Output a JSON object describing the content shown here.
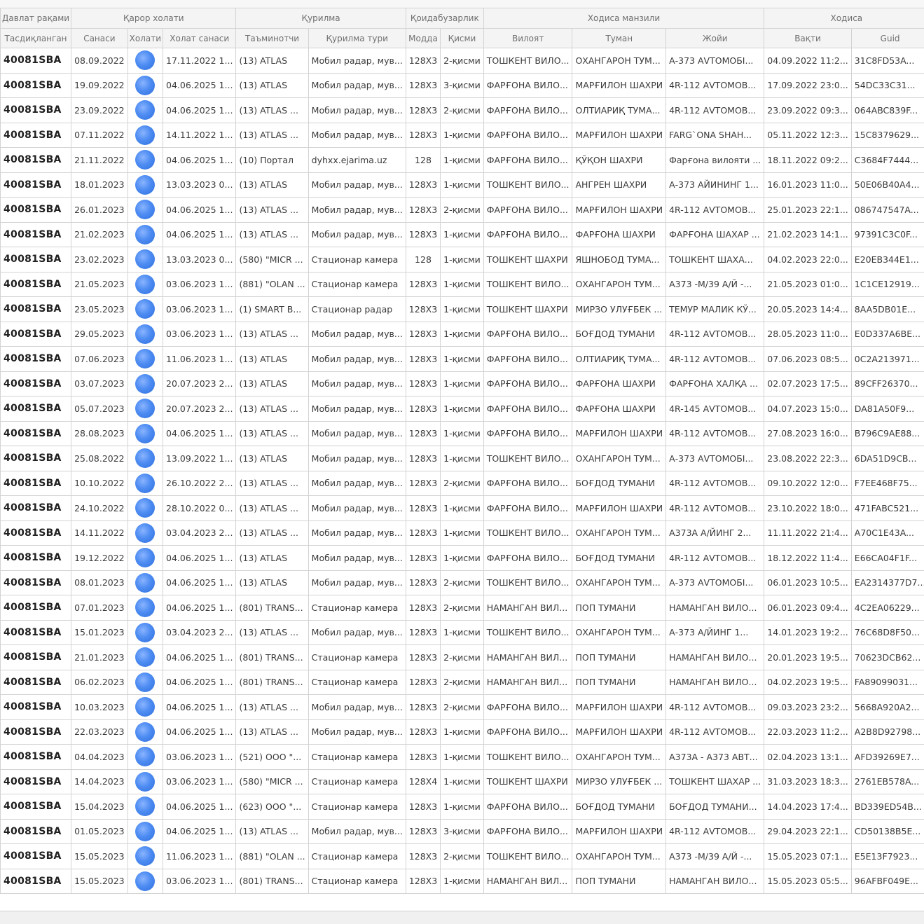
{
  "groups": [
    {
      "label": "Давлат рақами",
      "span": 1
    },
    {
      "label": "Қарор холати",
      "span": 3
    },
    {
      "label": "Қурилма",
      "span": 2
    },
    {
      "label": "Қоидабузарлик",
      "span": 2
    },
    {
      "label": "Ходиса манзили",
      "span": 3
    },
    {
      "label": "Ходиса",
      "span": 2
    }
  ],
  "columns": [
    {
      "label": "Тасдиқланган",
      "w": 102
    },
    {
      "label": "Санаси",
      "w": 89
    },
    {
      "label": "Холати",
      "w": 54
    },
    {
      "label": "Холат санаси",
      "w": 106
    },
    {
      "label": "Таъминотчи",
      "w": 95
    },
    {
      "label": "Қурилма тури",
      "w": 133
    },
    {
      "label": "Модда",
      "w": 66
    },
    {
      "label": "Қисми",
      "w": 66
    },
    {
      "label": "Вилоят",
      "w": 126
    },
    {
      "label": "Туман",
      "w": 128
    },
    {
      "label": "Жойи",
      "w": 130
    },
    {
      "label": "Вақти",
      "w": 124
    },
    {
      "label": "Guid",
      "w": 100
    }
  ],
  "rows": [
    [
      "40081SBA",
      "08.09.2022",
      "17.11.2022 1...",
      "(13) ATLAS",
      "Мобил радар, мув...",
      "128X3",
      "2-қисми",
      "ТОШКЕНТ ВИЛО...",
      "ОХАНГАРОН ТУМ...",
      "А-373 АVТОМОБІ...",
      "04.09.2022 11:2...",
      "31C8FD53A..."
    ],
    [
      "40081SBA",
      "19.09.2022",
      "04.06.2025 1...",
      "(13) ATLAS",
      "Мобил радар, мув...",
      "128X3",
      "3-қисми",
      "ФАРҒОНА ВИЛО...",
      "МАРҒИЛОН ШАХРИ",
      "4R-112 АVТОМОВ...",
      "17.09.2022 23:0...",
      "54DC33C31..."
    ],
    [
      "40081SBA",
      "23.09.2022",
      "04.06.2025 1...",
      "(13) ATLAS ...",
      "Мобил радар, мув...",
      "128X3",
      "2-қисми",
      "ФАРҒОНА ВИЛО...",
      "ОЛТИАРИҚ ТУМА...",
      "4R-112 АVТОМОВ...",
      "23.09.2022 09:3...",
      "064ABC839F..."
    ],
    [
      "40081SBA",
      "07.11.2022",
      "14.11.2022 1...",
      "(13) ATLAS ...",
      "Мобил радар, мув...",
      "128X3",
      "1-қисми",
      "ФАРҒОНА ВИЛО...",
      "МАРҒИЛОН ШАХРИ",
      "FARG`ONA SHAH...",
      "05.11.2022 12:3...",
      "15C8379629..."
    ],
    [
      "40081SBA",
      "21.11.2022",
      "04.06.2025 1...",
      "(10) Портал",
      "dyhxx.ejarima.uz",
      "128",
      "1-қисми",
      "ФАРҒОНА ВИЛО...",
      "ҚЎҚОН ШАХРИ",
      "Фарғона вилояти ...",
      "18.11.2022 09:2...",
      "C3684F7444..."
    ],
    [
      "40081SBA",
      "18.01.2023",
      "13.03.2023 0...",
      "(13) ATLAS",
      "Мобил радар, мув...",
      "128X3",
      "1-қисми",
      "ТОШКЕНТ ВИЛО...",
      "АНГРЕН ШАХРИ",
      "А-373 АЙИНИНГ 1...",
      "16.01.2023 11:0...",
      "50E06B40A4..."
    ],
    [
      "40081SBA",
      "26.01.2023",
      "04.06.2025 1...",
      "(13) ATLAS ...",
      "Мобил радар, мув...",
      "128X3",
      "2-қисми",
      "ФАРҒОНА ВИЛО...",
      "МАРҒИЛОН ШАХРИ",
      "4R-112 АVТОМОВ...",
      "25.01.2023 22:1...",
      "086747547A..."
    ],
    [
      "40081SBA",
      "21.02.2023",
      "04.06.2025 1...",
      "(13) ATLAS ...",
      "Мобил радар, мув...",
      "128X3",
      "1-қисми",
      "ФАРҒОНА ВИЛО...",
      "ФАРҒОНА ШАХРИ",
      "ФАРҒОНА ШАХАР ...",
      "21.02.2023 14:1...",
      "97391C3C0F..."
    ],
    [
      "40081SBA",
      "23.02.2023",
      "13.03.2023 0...",
      "(580) \"MICR ...",
      "Стационар камера",
      "128",
      "1-қисми",
      "ТОШКЕНТ ШАХРИ",
      "ЯШНОБОД ТУМА...",
      "ТОШКЕНТ ШАХА...",
      "04.02.2023 22:0...",
      "E20EB344E1..."
    ],
    [
      "40081SBA",
      "21.05.2023",
      "03.06.2023 1...",
      "(881) \"OLAN ...",
      "Стационар камера",
      "128X3",
      "1-қисми",
      "ТОШКЕНТ ВИЛО...",
      "ОХАНГАРОН ТУМ...",
      "А373 -М/39 А/Й -...",
      "21.05.2023 01:0...",
      "1C1CE12919..."
    ],
    [
      "40081SBA",
      "23.05.2023",
      "03.06.2023 1...",
      "(1) SMART B...",
      "Стационар радар",
      "128X3",
      "1-қисми",
      "ТОШКЕНТ ШАХРИ",
      "МИРЗО УЛУҒБЕК ...",
      "ТЕМУР МАЛИК КЎ...",
      "20.05.2023 14:4...",
      "8AA5DB01E..."
    ],
    [
      "40081SBA",
      "29.05.2023",
      "03.06.2023 1...",
      "(13) ATLAS ...",
      "Мобил радар, мув...",
      "128X3",
      "1-қисми",
      "ФАРҒОНА ВИЛО...",
      "БОҒДОД ТУМАНИ",
      "4R-112 АVТОМОВ...",
      "28.05.2023 11:0...",
      "E0D337A6BE..."
    ],
    [
      "40081SBA",
      "07.06.2023",
      "11.06.2023 1...",
      "(13) ATLAS",
      "Мобил радар, мув...",
      "128X3",
      "1-қисми",
      "ФАРҒОНА ВИЛО...",
      "ОЛТИАРИҚ ТУМА...",
      "4R-112 АVТОМОВ...",
      "07.06.2023 08:5...",
      "0C2A213971..."
    ],
    [
      "40081SBA",
      "03.07.2023",
      "20.07.2023 2...",
      "(13) ATLAS",
      "Мобил радар, мув...",
      "128X3",
      "1-қисми",
      "ФАРҒОНА ВИЛО...",
      "ФАРҒОНА ШАХРИ",
      "ФАРҒОНА ХАЛҚА ...",
      "02.07.2023 17:5...",
      "89CFF26370..."
    ],
    [
      "40081SBA",
      "05.07.2023",
      "20.07.2023 2...",
      "(13) ATLAS ...",
      "Мобил радар, мув...",
      "128X3",
      "1-қисми",
      "ФАРҒОНА ВИЛО...",
      "ФАРҒОНА ШАХРИ",
      "4R-145 АVТОМОВ...",
      "04.07.2023 15:0...",
      "DA81A50F9..."
    ],
    [
      "40081SBA",
      "28.08.2023",
      "04.06.2025 1...",
      "(13) ATLAS ...",
      "Мобил радар, мув...",
      "128X3",
      "1-қисми",
      "ФАРҒОНА ВИЛО...",
      "МАРҒИЛОН ШАХРИ",
      "4R-112 АVТОМОВ...",
      "27.08.2023 16:0...",
      "B796C9AE88..."
    ],
    [
      "40081SBA",
      "25.08.2022",
      "13.09.2022 1...",
      "(13) ATLAS",
      "Мобил радар, мув...",
      "128X3",
      "1-қисми",
      "ТОШКЕНТ ВИЛО...",
      "ОХАНГАРОН ТУМ...",
      "А-373 АVТОМОБІ...",
      "23.08.2022 22:3...",
      "6DA51D9CB..."
    ],
    [
      "40081SBA",
      "10.10.2022",
      "26.10.2022 2...",
      "(13) ATLAS ...",
      "Мобил радар, мув...",
      "128X3",
      "2-қисми",
      "ФАРҒОНА ВИЛО...",
      "БОҒДОД ТУМАНИ",
      "4R-112 АVТОМОВ...",
      "09.10.2022 12:0...",
      "F7EE468F75..."
    ],
    [
      "40081SBA",
      "24.10.2022",
      "28.10.2022 0...",
      "(13) ATLAS ...",
      "Мобил радар, мув...",
      "128X3",
      "1-қисми",
      "ФАРҒОНА ВИЛО...",
      "МАРҒИЛОН ШАХРИ",
      "4R-112 АVТОМОВ...",
      "23.10.2022 18:0...",
      "471FABC521..."
    ],
    [
      "40081SBA",
      "14.11.2022",
      "03.04.2023 2...",
      "(13) ATLAS ...",
      "Мобил радар, мув...",
      "128X3",
      "1-қисми",
      "ТОШКЕНТ ВИЛО...",
      "ОХАНГАРОН ТУМ...",
      "А373А А/ЙИНГ 2...",
      "11.11.2022 21:4...",
      "A70C1E43A..."
    ],
    [
      "40081SBA",
      "19.12.2022",
      "04.06.2025 1...",
      "(13) ATLAS",
      "Мобил радар, мув...",
      "128X3",
      "1-қисми",
      "ФАРҒОНА ВИЛО...",
      "БОҒДОД ТУМАНИ",
      "4R-112 АVТОМОВ...",
      "18.12.2022 11:4...",
      "E66CA04F1F..."
    ],
    [
      "40081SBA",
      "08.01.2023",
      "04.06.2025 1...",
      "(13) ATLAS",
      "Мобил радар, мув...",
      "128X3",
      "2-қисми",
      "ТОШКЕНТ ВИЛО...",
      "ОХАНГАРОН ТУМ...",
      "А-373 АVТОМОБІ...",
      "06.01.2023 10:5...",
      "EA2314377D7..."
    ],
    [
      "40081SBA",
      "07.01.2023",
      "04.06.2025 1...",
      "(801) TRANS...",
      "Стационар камера",
      "128X3",
      "2-қисми",
      "НАМАНГАН ВИЛ...",
      "ПОП ТУМАНИ",
      "НАМАНГАН ВИЛО...",
      "06.01.2023 09:4...",
      "4C2EA06229..."
    ],
    [
      "40081SBA",
      "15.01.2023",
      "03.04.2023 2...",
      "(13) ATLAS ...",
      "Мобил радар, мув...",
      "128X3",
      "1-қисми",
      "ТОШКЕНТ ВИЛО...",
      "ОХАНГАРОН ТУМ...",
      "А-373 А/ЙИНГ 1...",
      "14.01.2023 19:2...",
      "76C68D8F50..."
    ],
    [
      "40081SBA",
      "21.01.2023",
      "04.06.2025 1...",
      "(801) TRANS...",
      "Стационар камера",
      "128X3",
      "2-қисми",
      "НАМАНГАН ВИЛ...",
      "ПОП ТУМАНИ",
      "НАМАНГАН ВИЛО...",
      "20.01.2023 19:5...",
      "70623DCB62..."
    ],
    [
      "40081SBA",
      "06.02.2023",
      "04.06.2025 1...",
      "(801) TRANS...",
      "Стационар камера",
      "128X3",
      "2-қисми",
      "НАМАНГАН ВИЛ...",
      "ПОП ТУМАНИ",
      "НАМАНГАН ВИЛО...",
      "04.02.2023 19:5...",
      "FA89099031..."
    ],
    [
      "40081SBA",
      "10.03.2023",
      "04.06.2025 1...",
      "(13) ATLAS ...",
      "Мобил радар, мув...",
      "128X3",
      "2-қисми",
      "ФАРҒОНА ВИЛО...",
      "МАРҒИЛОН ШАХРИ",
      "4R-112 АVТОМОВ...",
      "09.03.2023 23:2...",
      "5668A920A2..."
    ],
    [
      "40081SBA",
      "22.03.2023",
      "04.06.2025 1...",
      "(13) ATLAS ...",
      "Мобил радар, мув...",
      "128X3",
      "1-қисми",
      "ФАРҒОНА ВИЛО...",
      "МАРҒИЛОН ШАХРИ",
      "4R-112 АVТОМОВ...",
      "22.03.2023 11:2...",
      "A2B8D92798..."
    ],
    [
      "40081SBA",
      "04.04.2023",
      "03.06.2023 1...",
      "(521) ООО \"...",
      "Стационар камера",
      "128X3",
      "1-қисми",
      "ТОШКЕНТ ВИЛО...",
      "ОХАНГАРОН ТУМ...",
      "А373А - А373 АВТ...",
      "02.04.2023 13:1...",
      "AFD39269E7..."
    ],
    [
      "40081SBA",
      "14.04.2023",
      "03.06.2023 1...",
      "(580) \"MICR ...",
      "Стационар камера",
      "128X4",
      "1-қисми",
      "ТОШКЕНТ ШАХРИ",
      "МИРЗО УЛУҒБЕК ...",
      "ТОШКЕНТ ШАХАР ...",
      "31.03.2023 18:3...",
      "2761EB578A..."
    ],
    [
      "40081SBA",
      "15.04.2023",
      "04.06.2025 1...",
      "(623) ООО \"...",
      "Стационар камера",
      "128X3",
      "1-қисми",
      "ФАРҒОНА ВИЛО...",
      "БОҒДОД ТУМАНИ",
      "БОҒДОД ТУМАНИ...",
      "14.04.2023 17:4...",
      "BD339ED54B..."
    ],
    [
      "40081SBA",
      "01.05.2023",
      "04.06.2025 1...",
      "(13) ATLAS ...",
      "Мобил радар, мув...",
      "128X3",
      "3-қисми",
      "ФАРҒОНА ВИЛО...",
      "МАРҒИЛОН ШАХРИ",
      "4R-112 АVТОМОВ...",
      "29.04.2023 22:1...",
      "CD50138B5E..."
    ],
    [
      "40081SBA",
      "15.05.2023",
      "11.06.2023 1...",
      "(881) \"OLAN ...",
      "Стационар камера",
      "128X3",
      "2-қисми",
      "ТОШКЕНТ ВИЛО...",
      "ОХАНГАРОН ТУМ...",
      "А373 -М/39 А/Й -...",
      "15.05.2023 07:1...",
      "E5E13F7923..."
    ],
    [
      "40081SBA",
      "15.05.2023",
      "03.06.2023 1...",
      "(801) TRANS...",
      "Стационар камера",
      "128X3",
      "1-қисми",
      "НАМАНГАН ВИЛ...",
      "ПОП ТУМАНИ",
      "НАМАНГАН ВИЛО...",
      "15.05.2023 05:5...",
      "96AFBF049E..."
    ]
  ],
  "status_icon": "blue-circle-icon",
  "colors": {
    "status_dot": "#4d8cf2",
    "header_bg": "#f4f4f4",
    "grid_line": "#d3d3d3"
  }
}
